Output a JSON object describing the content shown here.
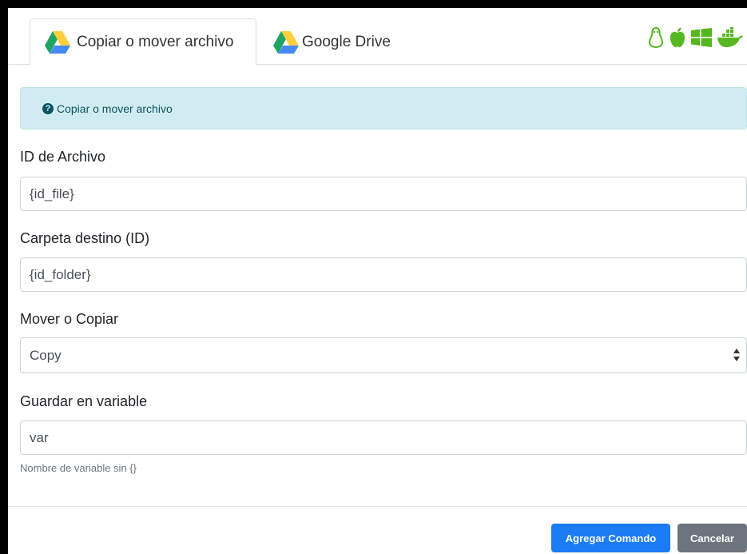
{
  "tabs": [
    {
      "label": "Copiar o mover archivo",
      "active": true,
      "icon": "google-drive-icon"
    },
    {
      "label": "Google Drive",
      "active": false,
      "icon": "google-drive-icon"
    }
  ],
  "os_icons": [
    "linux-icon",
    "apple-icon",
    "windows-icon",
    "docker-icon"
  ],
  "alert": {
    "text": "Copiar o mover archivo",
    "icon": "question-circle-icon"
  },
  "fields": {
    "file_id": {
      "label": "ID de Archivo",
      "value": "{id_file}"
    },
    "folder_id": {
      "label": "Carpeta destino (ID)",
      "value": "{id_folder}"
    },
    "action": {
      "label": "Mover o Copiar",
      "value": "Copy"
    },
    "variable": {
      "label": "Guardar en variable",
      "value": "var",
      "help": "Nombre de variable sin {}"
    }
  },
  "buttons": {
    "add": "Agregar Comando",
    "cancel": "Cancelar"
  },
  "colors": {
    "primary": "#1c7cf5",
    "secondary": "#6c757d",
    "alert_bg": "#d1ecf1",
    "os_icon": "#55b820"
  }
}
